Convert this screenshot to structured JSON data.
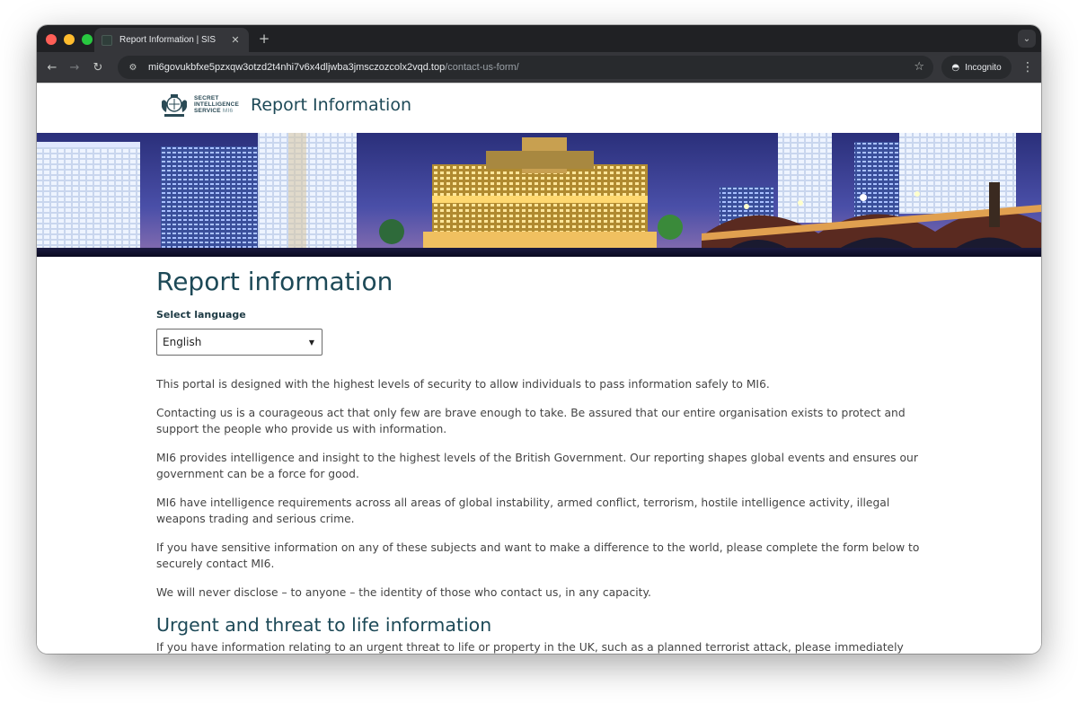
{
  "browser": {
    "tab_title": "Report Information | SIS",
    "tab_close_icon": "close-icon",
    "new_tab_label": "+",
    "url_host": "mi6govukbfxe5pzxqw3otzd2t4nhi7v6x4dljwba3jmsczozcolx2vqd.top",
    "url_path": "/contact-us-form/",
    "incognito_label": "Incognito"
  },
  "header": {
    "org_line1": "SECRET",
    "org_line2": "INTELLIGENCE",
    "org_line3": "SERVICE",
    "org_mi6": "MI6",
    "site_title": "Report Information"
  },
  "main": {
    "title": "Report information",
    "language_label": "Select language",
    "language_selected": "English",
    "paragraphs": [
      "This portal is designed with the highest levels of security to allow individuals to pass information safely to MI6.",
      "Contacting us is a courageous act that only few are brave enough to take. Be assured that our entire organisation exists to protect and support the people who provide us with information.",
      "MI6 provides intelligence and insight to the highest levels of the British Government. Our reporting shapes global events and ensures our government can be a force for good.",
      "MI6 have intelligence requirements across all areas of global instability, armed conflict, terrorism, hostile intelligence activity, illegal weapons trading and serious crime.",
      "If you have sensitive information on any of these subjects and want to make a difference to the world, please complete the form below to securely contact MI6.",
      "We will never disclose – to anyone – the identity of those who contact us, in any capacity."
    ],
    "urgent_heading": "Urgent and threat to life information",
    "urgent_text": "If you have information relating to an urgent threat to life or property in the UK, such as a planned terrorist attack, please immediately contact the"
  },
  "colors": {
    "heading": "#1d4957",
    "body_text": "#444444",
    "browser_frame": "#202124",
    "browser_toolbar": "#35363a"
  }
}
